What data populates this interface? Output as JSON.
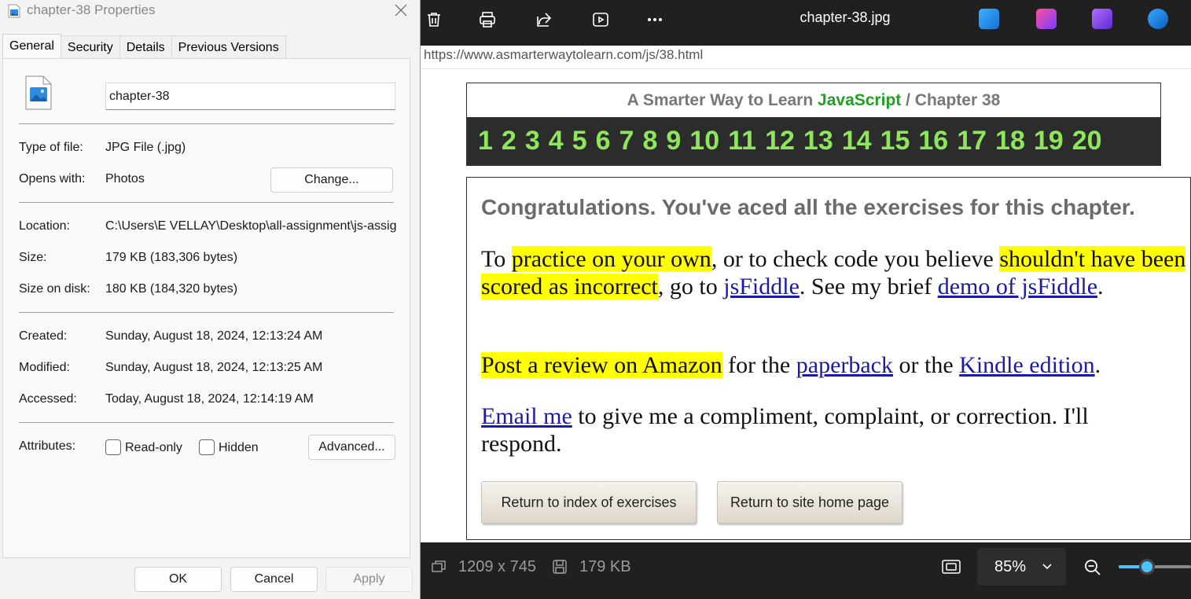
{
  "viewer": {
    "title": "chapter-38.jpg",
    "toolbar": [
      "delete",
      "print",
      "share",
      "slideshow",
      "more"
    ],
    "image": {
      "url": "https://www.asmarterwaytolearn.com/js/38.html",
      "header_prefix": "A Smarter Way to Learn",
      "header_js": "JavaScript",
      "header_suffix": "/ Chapter 38",
      "chapters": [
        "1",
        "2",
        "3",
        "4",
        "5",
        "6",
        "7",
        "8",
        "9",
        "10",
        "11",
        "12",
        "13",
        "14",
        "15",
        "16",
        "17",
        "18",
        "19",
        "20"
      ],
      "congrats": "Congratulations. You've aced all the exercises for this chapter.",
      "p1": {
        "t1": "To ",
        "h1": "practice on your own",
        "t2": ", or to check code you believe ",
        "h2": "shouldn't have been scored as incorrect",
        "t3": ", go to ",
        "l1": "jsFiddle",
        "t4": ". See my brief ",
        "l2": "demo of jsFiddle",
        "t5": "."
      },
      "p2": {
        "h1": "Post a review on Amazon",
        "t1": " for the ",
        "l1": "paperback",
        "t2": " or the ",
        "l2": "Kindle edition",
        "t3": "."
      },
      "p3": {
        "l1": "Email me",
        "t1": " to give me a compliment, complaint, or correction. I'll respond."
      },
      "btn_index": "Return to index of exercises",
      "btn_home": "Return to site home page"
    },
    "status": {
      "dimensions": "1209 x 745",
      "file_size": "179 KB",
      "zoom": "85%",
      "zoom_fraction": 0.85
    },
    "colors": {
      "accent": "#4cc2ff",
      "highlight": "#ffff00",
      "link": "#1a1aa6",
      "chapter_green": "#8ee65c"
    }
  },
  "dialog": {
    "title": "chapter-38 Properties",
    "tabs": [
      "General",
      "Security",
      "Details",
      "Previous Versions"
    ],
    "name": "chapter-38",
    "type_label": "Type of file:",
    "type_value": "JPG File (.jpg)",
    "opens_label": "Opens with:",
    "opens_value": "Photos",
    "change_button": "Change...",
    "location_label": "Location:",
    "location_value": "C:\\Users\\E VELLAY\\Desktop\\all-assignment\\js-assig",
    "size_label": "Size:",
    "size_value": "179 KB (183,306 bytes)",
    "disk_label": "Size on disk:",
    "disk_value": "180 KB (184,320 bytes)",
    "created_label": "Created:",
    "created_value": "Sunday, August 18, 2024, 12:13:24 AM",
    "modified_label": "Modified:",
    "modified_value": "Sunday, August 18, 2024, 12:13:25 AM",
    "accessed_label": "Accessed:",
    "accessed_value": "Today, August 18, 2024, 12:14:19 AM",
    "attributes_label": "Attributes:",
    "readonly_label": "Read-only",
    "hidden_label": "Hidden",
    "advanced_button": "Advanced...",
    "ok_button": "OK",
    "cancel_button": "Cancel",
    "apply_button": "Apply"
  }
}
